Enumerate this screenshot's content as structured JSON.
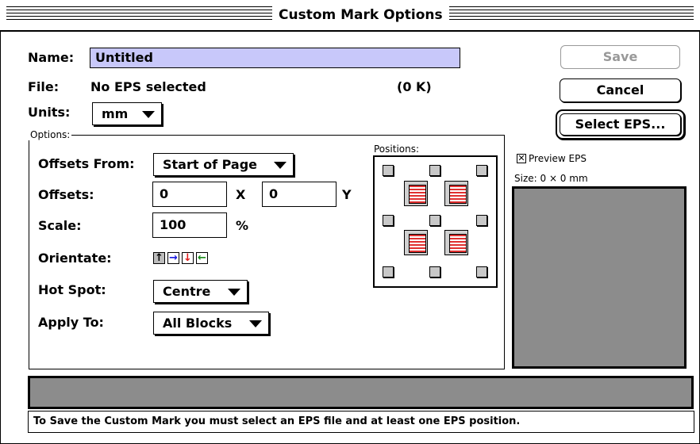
{
  "window": {
    "title": "Custom Mark Options"
  },
  "form": {
    "name_label": "Name:",
    "name_value": "Untitled",
    "file_label": "File:",
    "file_value": "No EPS selected",
    "file_size": "(0 K)",
    "units_label": "Units:",
    "units_value": "mm"
  },
  "buttons": {
    "save": "Save",
    "cancel": "Cancel",
    "select_eps": "Select EPS..."
  },
  "options": {
    "group_label": "Options:",
    "offsets_from_label": "Offsets From:",
    "offsets_from_value": "Start of Page",
    "offsets_label": "Offsets:",
    "offset_x": "0",
    "offset_x_unit": "X",
    "offset_y": "0",
    "offset_y_unit": "Y",
    "scale_label": "Scale:",
    "scale_value": "100",
    "scale_unit": "%",
    "orientate_label": "Orientate:",
    "hotspot_label": "Hot Spot:",
    "hotspot_value": "Centre",
    "apply_to_label": "Apply To:",
    "apply_to_value": "All Blocks"
  },
  "positions": {
    "label": "Positions:"
  },
  "preview": {
    "checkbox_label": "Preview EPS",
    "checked": true,
    "size_text": "Size: 0 × 0 mm"
  },
  "status_message": "To Save the Custom Mark you must select an EPS file and at least one EPS position.",
  "colors": {
    "name_field_bg": "#c8c8fa",
    "preview_bg": "#8c8c8c",
    "arrow_up": "#000000",
    "arrow_right": "#1a1ae0",
    "arrow_down": "#e01a1a",
    "arrow_left": "#1a8c1a"
  },
  "icons": [
    "arrow-up-icon",
    "arrow-right-icon",
    "arrow-down-icon",
    "arrow-left-icon",
    "eps-document-icon",
    "checkbox-icon",
    "popup-triangle-icon"
  ]
}
